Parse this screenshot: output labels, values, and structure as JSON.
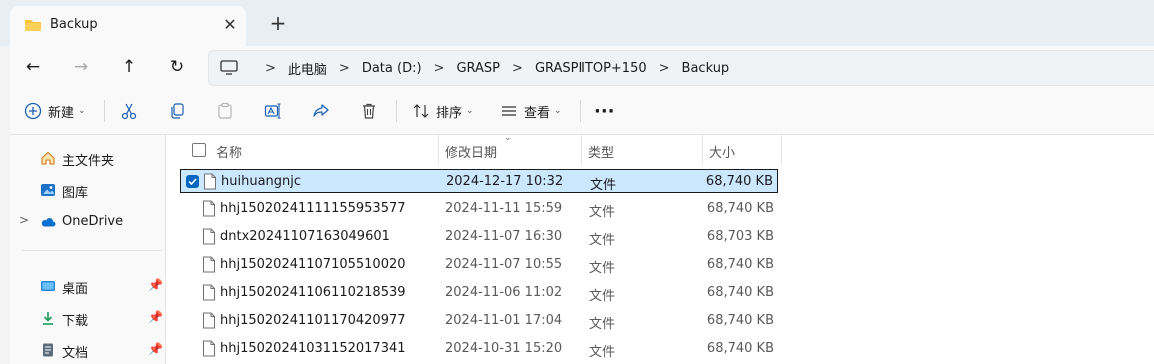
{
  "tab": {
    "title": "Backup",
    "close_glyph": "✕",
    "new_glyph": "+"
  },
  "nav": {
    "back_glyph": "←",
    "forward_glyph": "→",
    "up_glyph": "↑",
    "refresh_glyph": "↻"
  },
  "breadcrumb": {
    "separator": ">",
    "items": [
      "此电脑",
      "Data (D:)",
      "GRASP",
      "GRASPⅡTOP+150",
      "Backup"
    ]
  },
  "toolbar": {
    "new_label": "新建",
    "sort_label": "排序",
    "view_label": "查看",
    "more_glyph": "···"
  },
  "sidebar": {
    "items": [
      {
        "label": "主文件夹",
        "icon": "home-icon"
      },
      {
        "label": "图库",
        "icon": "gallery-icon"
      },
      {
        "label": "OneDrive",
        "icon": "cloud-icon",
        "chevron": ">"
      },
      {
        "label": "桌面",
        "icon": "desktop-icon",
        "pinned": true
      },
      {
        "label": "下载",
        "icon": "download-icon",
        "pinned": true
      },
      {
        "label": "文档",
        "icon": "document-icon",
        "pinned": true
      }
    ]
  },
  "columns": {
    "name": "名称",
    "modified": "修改日期",
    "type": "类型",
    "size": "大小"
  },
  "files": [
    {
      "name": "huihuangnjc",
      "modified": "2024-12-17 10:32",
      "type": "文件",
      "size": "68,740 KB",
      "selected": true
    },
    {
      "name": "hhj15020241111155953577",
      "modified": "2024-11-11 15:59",
      "type": "文件",
      "size": "68,740 KB"
    },
    {
      "name": "dntx20241107163049601",
      "modified": "2024-11-07 16:30",
      "type": "文件",
      "size": "68,703 KB"
    },
    {
      "name": "hhj15020241107105510020",
      "modified": "2024-11-07 10:55",
      "type": "文件",
      "size": "68,740 KB"
    },
    {
      "name": "hhj15020241106110218539",
      "modified": "2024-11-06 11:02",
      "type": "文件",
      "size": "68,740 KB"
    },
    {
      "name": "hhj15020241101170420977",
      "modified": "2024-11-01 17:04",
      "type": "文件",
      "size": "68,740 KB"
    },
    {
      "name": "hhj15020241031152017341",
      "modified": "2024-10-31 15:20",
      "type": "文件",
      "size": "68,740 KB"
    }
  ],
  "colors": {
    "accent": "#0067c0",
    "selection": "#cce8ff",
    "folder": "#f8c23a"
  }
}
